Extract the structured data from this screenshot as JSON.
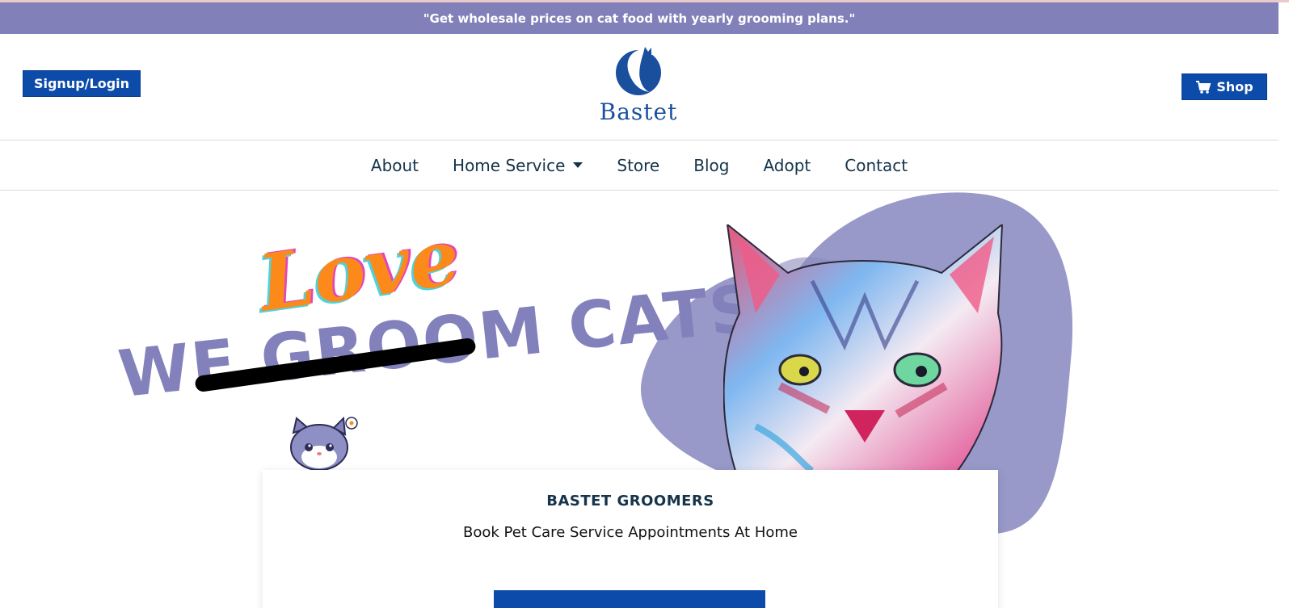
{
  "promo_bar": {
    "text": "\"Get wholesale prices on cat food with yearly grooming plans.\""
  },
  "header": {
    "signup_label": "Signup/Login",
    "shop_label": "Shop",
    "logo_text": "Bastet"
  },
  "nav": {
    "items": [
      {
        "label": "About"
      },
      {
        "label": "Home Service"
      },
      {
        "label": "Store"
      },
      {
        "label": "Blog"
      },
      {
        "label": "Adopt"
      },
      {
        "label": "Contact"
      }
    ]
  },
  "hero": {
    "love_word": "Love",
    "tagline": [
      "WE",
      "GROOM",
      "CATS"
    ]
  },
  "card": {
    "title": "BASTET GROOMERS",
    "subtitle": "Book Pet Care Service Appointments At Home"
  },
  "colors": {
    "brand_blue": "#0c4ba9",
    "promo_purple": "#8180b9",
    "blob_purple": "#9899c8",
    "love_orange": "#fb8a1a"
  },
  "icons": {
    "cart": "cart-icon",
    "logo": "cat-silhouette-logo-icon",
    "caret": "caret-down-icon"
  }
}
